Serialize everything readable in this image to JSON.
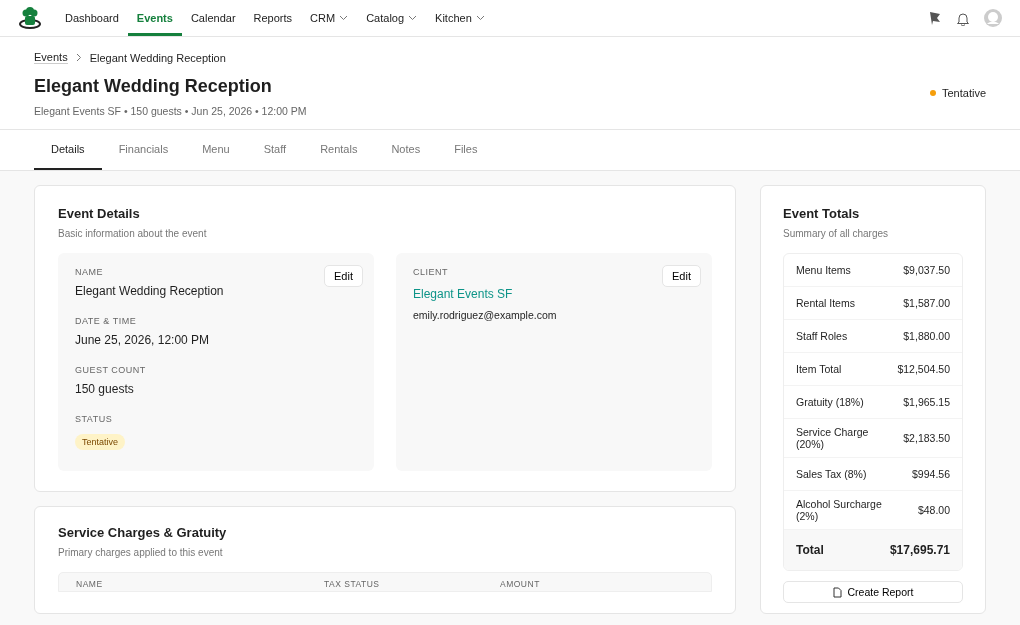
{
  "nav": {
    "items": [
      {
        "label": "Dashboard",
        "selected": false,
        "dropdown": false
      },
      {
        "label": "Events",
        "selected": true,
        "dropdown": false
      },
      {
        "label": "Calendar",
        "selected": false,
        "dropdown": false
      },
      {
        "label": "Reports",
        "selected": false,
        "dropdown": false
      },
      {
        "label": "CRM",
        "selected": false,
        "dropdown": true
      },
      {
        "label": "Catalog",
        "selected": false,
        "dropdown": true
      },
      {
        "label": "Kitchen",
        "selected": false,
        "dropdown": true
      }
    ]
  },
  "breadcrumb": [
    "Events",
    "Elegant Wedding Reception"
  ],
  "title": "Elegant Wedding Reception",
  "subtitle": "Elegant Events SF • 150 guests • Jun 25, 2026 • 12:00 PM",
  "status": {
    "label": "Tentative",
    "color": "#f59e0b"
  },
  "tabs": [
    {
      "label": "Details",
      "selected": true
    },
    {
      "label": "Financials",
      "selected": false
    },
    {
      "label": "Menu",
      "selected": false
    },
    {
      "label": "Staff",
      "selected": false
    },
    {
      "label": "Rentals",
      "selected": false
    },
    {
      "label": "Notes",
      "selected": false
    },
    {
      "label": "Files",
      "selected": false
    }
  ],
  "details": {
    "title": "Event Details",
    "subtitle": "Basic information about the event",
    "edit_label": "Edit",
    "fields": [
      {
        "label": "NAME",
        "value": "Elegant Wedding Reception",
        "kind": "text"
      },
      {
        "label": "DATE & TIME",
        "value": "June 25, 2026, 12:00 PM",
        "kind": "text"
      },
      {
        "label": "GUEST COUNT",
        "value": "150 guests",
        "kind": "text"
      },
      {
        "label": "STATUS",
        "value": "Tentative",
        "kind": "badge"
      }
    ],
    "client": {
      "label": "CLIENT",
      "edit_label": "Edit",
      "name": "Elegant Events SF",
      "email": "emily.rodriguez@example.com"
    }
  },
  "service": {
    "title": "Service Charges & Gratuity",
    "subtitle": "Primary charges applied to this event",
    "columns": [
      "NAME",
      "TAX STATUS",
      "AMOUNT"
    ]
  },
  "totals": {
    "title": "Event Totals",
    "subtitle": "Summary of all charges",
    "rows": [
      {
        "label": "Menu Items",
        "amount": "$9,037.50",
        "kind": "row"
      },
      {
        "label": "Rental Items",
        "amount": "$1,587.00",
        "kind": "row"
      },
      {
        "label": "Staff Roles",
        "amount": "$1,880.00",
        "kind": "row"
      },
      {
        "label": "Item Total",
        "amount": "$12,504.50",
        "kind": "row"
      },
      {
        "label": "Gratuity (18%)",
        "amount": "$1,965.15",
        "kind": "row"
      },
      {
        "label": "Service Charge (20%)",
        "amount": "$2,183.50",
        "kind": "row"
      },
      {
        "label": "Sales Tax (8%)",
        "amount": "$994.56",
        "kind": "row"
      },
      {
        "label": "Alcohol Surcharge (2%)",
        "amount": "$48.00",
        "kind": "row"
      },
      {
        "label": "Total",
        "amount": "$17,695.71",
        "kind": "total"
      }
    ],
    "button": "Create Report"
  }
}
